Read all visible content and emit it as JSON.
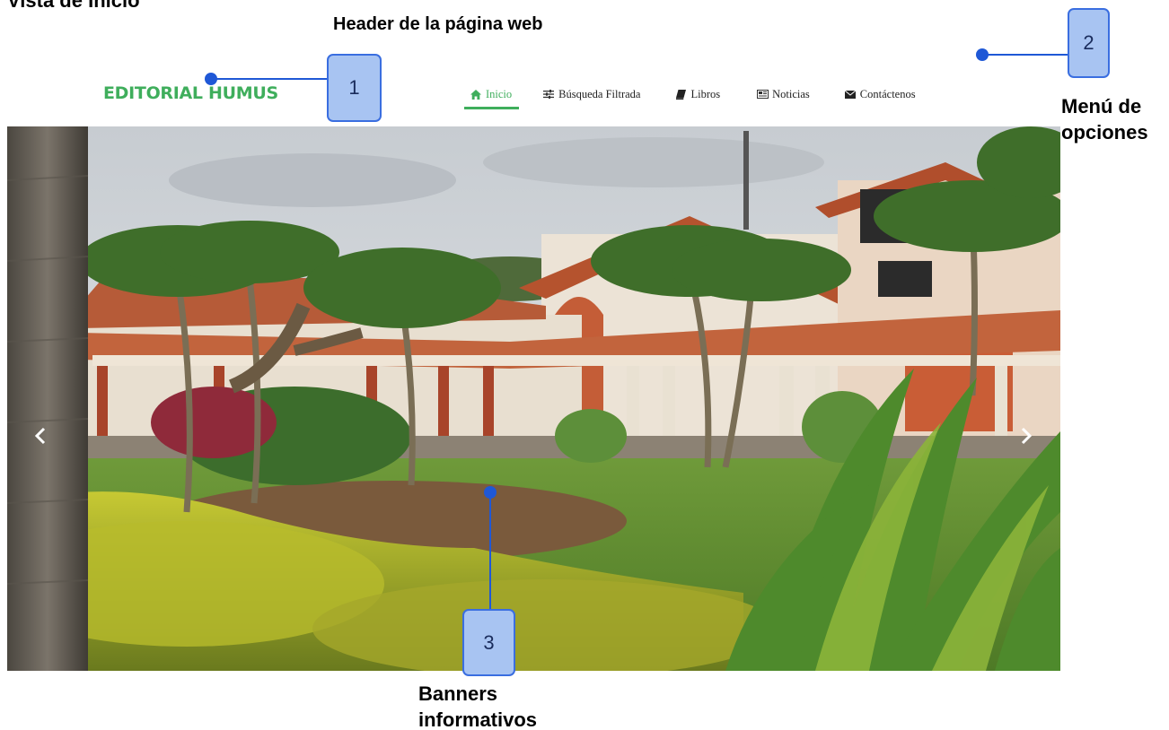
{
  "document": {
    "title": "Vista de Inicio",
    "header_caption": "Header de la página web"
  },
  "header": {
    "brand": "EDITORIAL HUMUS",
    "brand_color": "#3fae5c",
    "nav": [
      {
        "label": "Inicio",
        "icon": "home-icon",
        "active": true
      },
      {
        "label": "Búsqueda Filtrada",
        "icon": "sliders-icon",
        "active": false
      },
      {
        "label": "Libros",
        "icon": "book-icon",
        "active": false
      },
      {
        "label": "Noticias",
        "icon": "newspaper-icon",
        "active": false
      },
      {
        "label": "Contáctenos",
        "icon": "envelope-icon",
        "active": false
      }
    ]
  },
  "annotations": {
    "callout_1": "1",
    "callout_2": "2",
    "callout_3": "3",
    "menu_caption_line1": "Menú de",
    "menu_caption_line2": "opciones",
    "banner_caption_line1": "Banners",
    "banner_caption_line2": "informativos",
    "callout_color": "#1f58d6",
    "callout_fill": "#a8c4f2"
  },
  "carousel": {
    "image": "campus-garden-photo",
    "prev_icon": "chevron-left-icon",
    "next_icon": "chevron-right-icon"
  }
}
